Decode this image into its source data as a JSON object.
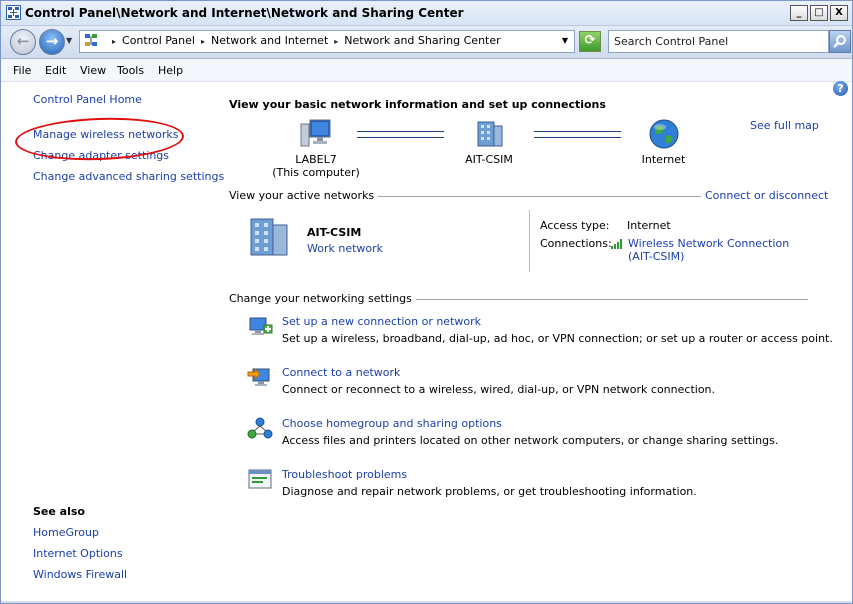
{
  "window": {
    "title": "Control Panel\\Network and Internet\\Network and Sharing Center",
    "controls": {
      "minimize": "_",
      "maximize": "□",
      "close": "X"
    }
  },
  "address": {
    "crumbs": [
      "Control Panel",
      "Network and Internet",
      "Network and Sharing Center"
    ],
    "search_placeholder": "Search Control Panel"
  },
  "menu": [
    "File",
    "Edit",
    "View",
    "Tools",
    "Help"
  ],
  "left_pane": {
    "links": [
      "Control Panel Home",
      "Manage wireless networks",
      "Change adapter settings",
      "Change advanced sharing settings"
    ],
    "see_also_title": "See also",
    "see_also": [
      "HomeGroup",
      "Internet Options",
      "Windows Firewall"
    ]
  },
  "main": {
    "title": "View your basic network information and set up connections",
    "see_full_map": "See full map",
    "map": {
      "computer_label": "LABEL7",
      "computer_sublabel": "(This computer)",
      "network_label": "AIT-CSIM",
      "internet_label": "Internet"
    },
    "active_networks": {
      "header": "View your active networks",
      "connect_link": "Connect or disconnect",
      "name": "AIT-CSIM",
      "type": "Work network",
      "access_type_label": "Access type:",
      "access_type_value": "Internet",
      "connections_label": "Connections:",
      "connection_value_line1": "Wireless Network Connection",
      "connection_value_line2": "(AIT-CSIM)"
    },
    "settings": {
      "header": "Change your networking settings",
      "tasks": [
        {
          "title": "Set up a new connection or network",
          "desc": "Set up a wireless, broadband, dial-up, ad hoc, or VPN connection; or set up a router or access point."
        },
        {
          "title": "Connect to a network",
          "desc": "Connect or reconnect to a wireless, wired, dial-up, or VPN network connection."
        },
        {
          "title": "Choose homegroup and sharing options",
          "desc": "Access files and printers located on other network computers, or change sharing settings."
        },
        {
          "title": "Troubleshoot problems",
          "desc": "Diagnose and repair network problems, or get troubleshooting information."
        }
      ]
    }
  },
  "colors": {
    "link": "#1a3fa8",
    "annotation": "#e01010"
  }
}
